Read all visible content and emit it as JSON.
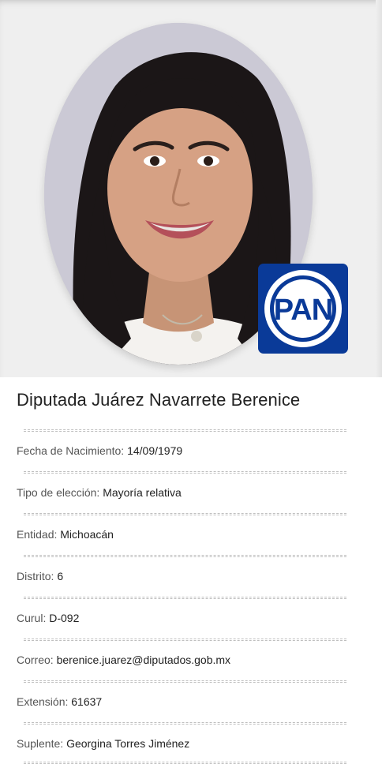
{
  "profile": {
    "name": "Diputada Juárez Navarrete Berenice",
    "party": "PAN",
    "party_color": "#0a3a98",
    "photo": "portrait-photo",
    "fields": [
      {
        "label": "Fecha de Nacimiento:",
        "value": "14/09/1979"
      },
      {
        "label": "Tipo de elección:",
        "value": "Mayoría relativa"
      },
      {
        "label": "Entidad:",
        "value": "Michoacán"
      },
      {
        "label": "Distrito:",
        "value": "6"
      },
      {
        "label": "Curul:",
        "value": "D-092"
      },
      {
        "label": "Correo:",
        "value": "berenice.juarez@diputados.gob.mx"
      },
      {
        "label": "Extensión:",
        "value": "61637"
      },
      {
        "label": "Suplente:",
        "value": "Georgina Torres Jiménez"
      }
    ]
  }
}
